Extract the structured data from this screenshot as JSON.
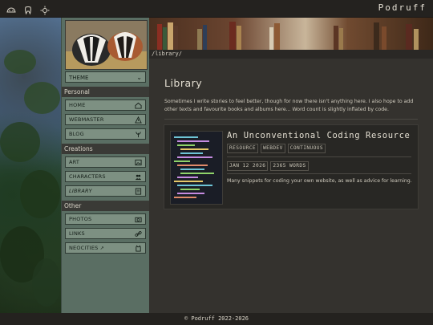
{
  "topbar": {
    "icons": [
      "badger-icon",
      "tooth-icon",
      "sun-icon"
    ],
    "brand": "Podruff"
  },
  "sidebar": {
    "theme_label": "THEME",
    "sections": {
      "personal": "Personal",
      "creations": "Creations",
      "other": "Other"
    },
    "items": [
      {
        "label": "HOME",
        "icon": "home-icon"
      },
      {
        "label": "WEBMASTER",
        "icon": "warning-icon"
      },
      {
        "label": "BLOG",
        "icon": "plant-icon"
      },
      {
        "label": "ART",
        "icon": "image-icon"
      },
      {
        "label": "CHARACTERS",
        "icon": "people-icon"
      },
      {
        "label": "LIBRARY",
        "icon": "book-icon"
      },
      {
        "label": "PHOTOS",
        "icon": "camera-icon"
      },
      {
        "label": "LINKS",
        "icon": "link-icon"
      },
      {
        "label": "NEOCITIES",
        "icon": "cat-icon"
      }
    ]
  },
  "breadcrumb": "/library/",
  "main": {
    "title": "Library",
    "intro": "Sometimes I write stories to feel better, though for now there isn't anything here. I also hope to add other texts and favourite books and albums here... Word count is slightly inflated by code.",
    "card": {
      "title": "An Unconventional Coding Resource",
      "tags": [
        "RESOURCE",
        "WEBDEV",
        "CONTINUOUS"
      ],
      "date": "JAN 12 2026",
      "words": "2365 WORDS",
      "description": "Many snippets for coding your own website, as well as advice for learning."
    }
  },
  "footer": "© Podruff 2022-2026"
}
